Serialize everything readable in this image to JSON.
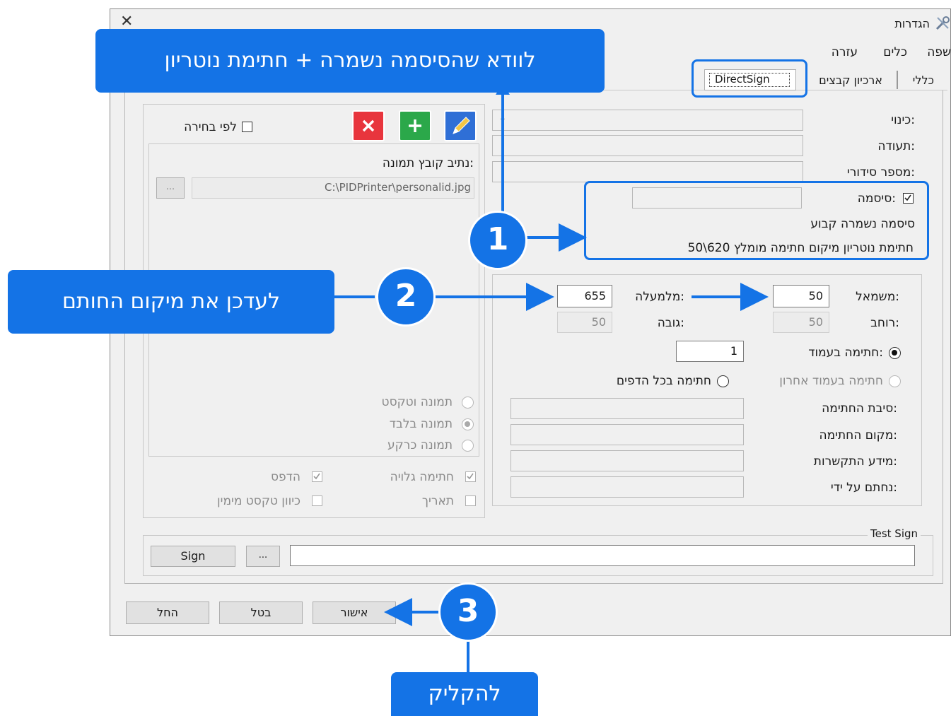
{
  "window": {
    "title": "הגדרות",
    "close": "✕"
  },
  "menu": [
    "שפה",
    "כלים",
    "עזרה"
  ],
  "tabs": [
    "כללי",
    "ארכיון קבצים",
    "DirectSign"
  ],
  "left": {
    "labels": {
      "alias": "כינוי:",
      "certificate": "תעודה:",
      "serial": "מספר סידורי:",
      "password": "סיסמה:",
      "saved": "סיסמה נשמרה קבוע",
      "notary": "חתימת נוטריון מיקום חתימה מומלץ 620\\50"
    }
  },
  "position": {
    "left_label": "משמאל:",
    "left_value": "50",
    "top_label": "מלמעלה:",
    "top_value": "655",
    "width_label": "רוחב:",
    "width_value": "50",
    "height_label": "גובה:",
    "height_value": "50",
    "page_label": "חתימה בעמוד:",
    "page_value": "1",
    "last_page": "חתימה בעמוד אחרון",
    "all_pages": "חתימה בכל הדפים"
  },
  "info_fields": [
    "סיבת החתימה:",
    "מקום החתימה:",
    "מידע התקשרות:",
    "נחתם על ידי:"
  ],
  "image_panel": {
    "by_choice": "לפי בחירה",
    "path_label": "נתיב קובץ תמונה:",
    "path_value": "C:\\PIDPrinter\\personalid.jpg",
    "browse": "...",
    "options": [
      "תמונה וטקסט",
      "תמונה בלבד",
      "תמונה כרקע"
    ],
    "visible_sig": "חתימה גלויה",
    "print": "הדפס",
    "date": "תאריך",
    "rtl_text": "כיוון טקסט מימין"
  },
  "test_sign": {
    "title": "Test Sign",
    "sign": "Sign",
    "browse": "..."
  },
  "footer": {
    "ok": "אישור",
    "cancel": "בטל",
    "apply": "החל"
  },
  "annotations": {
    "callout1": "לוודא שהסיסמה נשמרה + חתימת נוטריון",
    "callout2": "לעדכן את מיקום החותם",
    "callout3": "להקליק",
    "badge1": "1",
    "badge2": "2",
    "badge3": "3"
  },
  "colors": {
    "accent": "#1473e6",
    "delete": "#e8353d",
    "add": "#2ba84a",
    "edit": "#2f6fd6"
  }
}
